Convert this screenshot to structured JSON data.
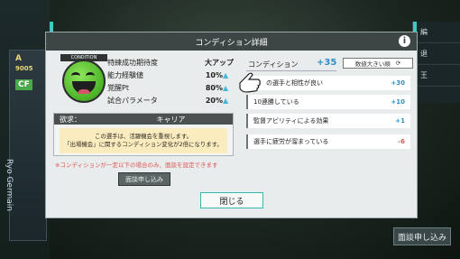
{
  "modal": {
    "title": "コンディション詳細",
    "info_icon": "info-icon"
  },
  "character": {
    "badge": "CONDITION",
    "face_icon": "grinning-face-icon"
  },
  "stats": [
    {
      "label": "特練成功期待度",
      "value": "大アップ",
      "arrow": ""
    },
    {
      "label": "能力経験値",
      "value": "10%",
      "arrow": "▲"
    },
    {
      "label": "覚醒Pt",
      "value": "80%",
      "arrow": "▲"
    },
    {
      "label": "試合パラメータ",
      "value": "20%",
      "arrow": "▲"
    }
  ],
  "desire": {
    "key": "欲求：",
    "value": "キャリア",
    "message_line1": "この選手は、活躍機会を重視します。",
    "message_line2": "「出場機会」に関するコンディション変化が2倍になります。"
  },
  "warning": "※コンディションが一定以下の場合のみ、面談を設定できます",
  "buttons": {
    "interview": "面談申し込み",
    "close": "閉じる"
  },
  "condition": {
    "label": "コンディション",
    "total": "+35",
    "sort_label": "数値大きい順",
    "items": [
      {
        "label": "の選手と相性が良い",
        "value": "+30",
        "sign": "pos"
      },
      {
        "label": "10連勝している",
        "value": "+10",
        "sign": "pos"
      },
      {
        "label": "監督アビリティによる効果",
        "value": "+1",
        "sign": "pos"
      },
      {
        "label": "選手に疲労が溜まっている",
        "value": "-6",
        "sign": "neg"
      }
    ]
  },
  "background": {
    "player_rating": "A",
    "player_number": "9005",
    "player_position": "CF",
    "player_name": "Ryo Germain",
    "side_items": [
      "編",
      "退",
      "王"
    ],
    "side_button": "面談申し込み"
  },
  "colors": {
    "accent": "#3ec9c2",
    "positive": "#2e8fc9",
    "negative": "#e05555",
    "header": "#3d4645"
  }
}
